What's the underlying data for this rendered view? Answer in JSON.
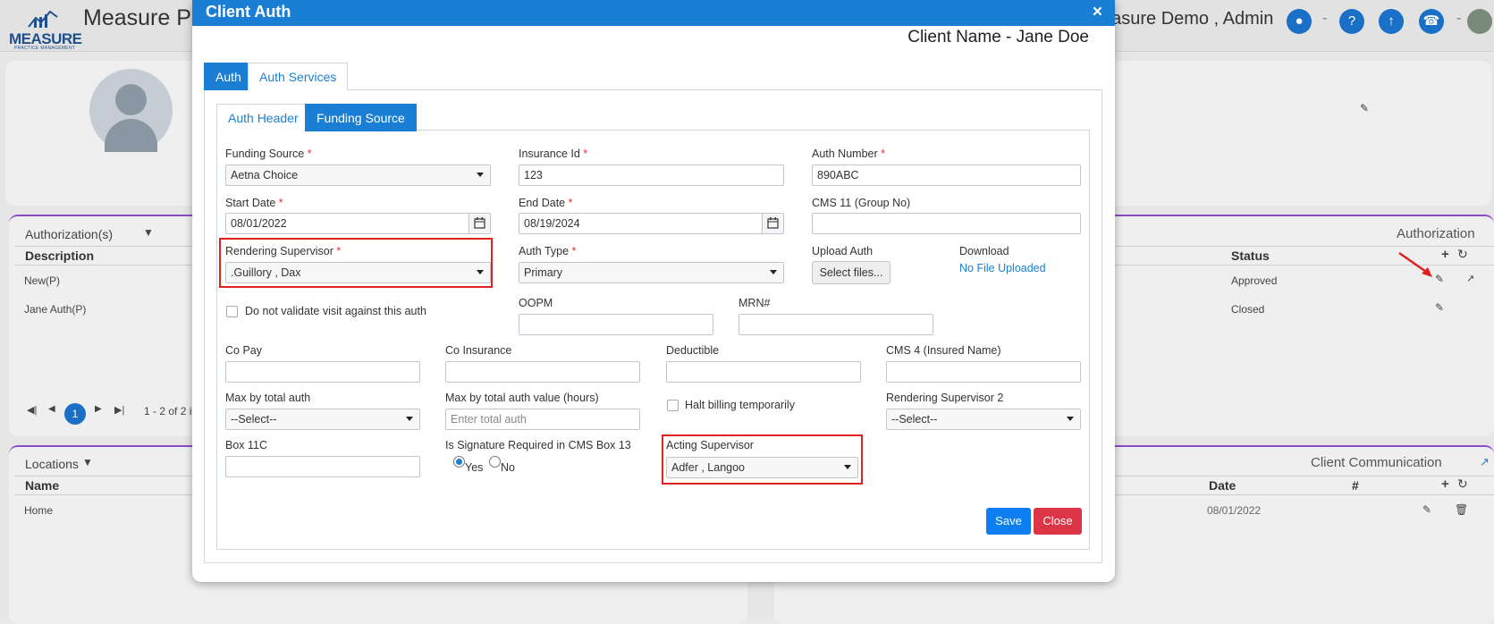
{
  "background": {
    "app_title": "Measure P",
    "logo_text": "MEASURE",
    "logo_subtext": "PRACTICE MANAGEMENT",
    "user": "easure Demo , Admin",
    "auth_section": {
      "heading": "Authorization(s)",
      "right_heading": "Authorization",
      "col_description": "Description",
      "col_status": "Status",
      "rows": [
        {
          "description": "New(P)",
          "status": "Approved"
        },
        {
          "description": "Jane Auth(P)",
          "status": "Closed"
        }
      ],
      "pager_current": "1",
      "pager_text": "1 - 2 of 2 it"
    },
    "locations": {
      "heading": "Locations",
      "col_name": "Name",
      "row_name": "Home"
    },
    "communication": {
      "heading": "Client Communication",
      "col_date": "Date",
      "col_hash": "#",
      "row_date": "08/01/2022"
    }
  },
  "modal": {
    "title": "Client Auth",
    "close_glyph": "×",
    "client_name": "Client Name - Jane Doe",
    "outer_tabs": [
      "Auth",
      "Auth Services"
    ],
    "inner_tabs": [
      "Auth Header",
      "Funding Source"
    ],
    "fields": {
      "funding_source": {
        "label": "Funding Source",
        "value": "Aetna Choice"
      },
      "insurance_id": {
        "label": "Insurance Id",
        "value": "123"
      },
      "auth_number": {
        "label": "Auth Number",
        "value": "890ABC"
      },
      "start_date": {
        "label": "Start Date",
        "value": "08/01/2022"
      },
      "end_date": {
        "label": "End Date",
        "value": "08/19/2024"
      },
      "cms11": {
        "label": "CMS 11 (Group No)",
        "value": ""
      },
      "rendering_supervisor": {
        "label": "Rendering Supervisor",
        "value": ".Guillory , Dax"
      },
      "auth_type": {
        "label": "Auth Type",
        "value": "Primary"
      },
      "upload_auth": {
        "label": "Upload Auth",
        "button": "Select files..."
      },
      "download": {
        "label": "Download",
        "link": "No File Uploaded"
      },
      "no_validate": {
        "label": "Do not validate visit against this auth"
      },
      "oopm": {
        "label": "OOPM",
        "value": ""
      },
      "mrn": {
        "label": "MRN#",
        "value": ""
      },
      "co_pay": {
        "label": "Co Pay",
        "value": ""
      },
      "co_insurance": {
        "label": "Co Insurance",
        "value": ""
      },
      "deductible": {
        "label": "Deductible",
        "value": ""
      },
      "cms4": {
        "label": "CMS 4 (Insured Name)",
        "value": ""
      },
      "max_total_auth": {
        "label": "Max by total auth",
        "value": "--Select--"
      },
      "max_total_auth_hours": {
        "label": "Max by total auth value (hours)",
        "placeholder": "Enter total auth"
      },
      "halt_billing": {
        "label": "Halt billing temporarily"
      },
      "rendering_supervisor2": {
        "label": "Rendering Supervisor 2",
        "value": "--Select--"
      },
      "box11c": {
        "label": "Box 11C",
        "value": ""
      },
      "signature_required": {
        "label": "Is Signature Required in CMS Box 13",
        "yes": "Yes",
        "no": "No"
      },
      "acting_supervisor": {
        "label": "Acting Supervisor",
        "value": "Adfer , Langoo"
      }
    },
    "required_mark": "*",
    "save_label": "Save",
    "close_label": "Close"
  },
  "colors": {
    "primary": "#1a7fd4",
    "save": "#0d7ff2",
    "close": "#dc3545",
    "highlight": "#e0221e",
    "panel_accent": "#8a4cc5"
  }
}
